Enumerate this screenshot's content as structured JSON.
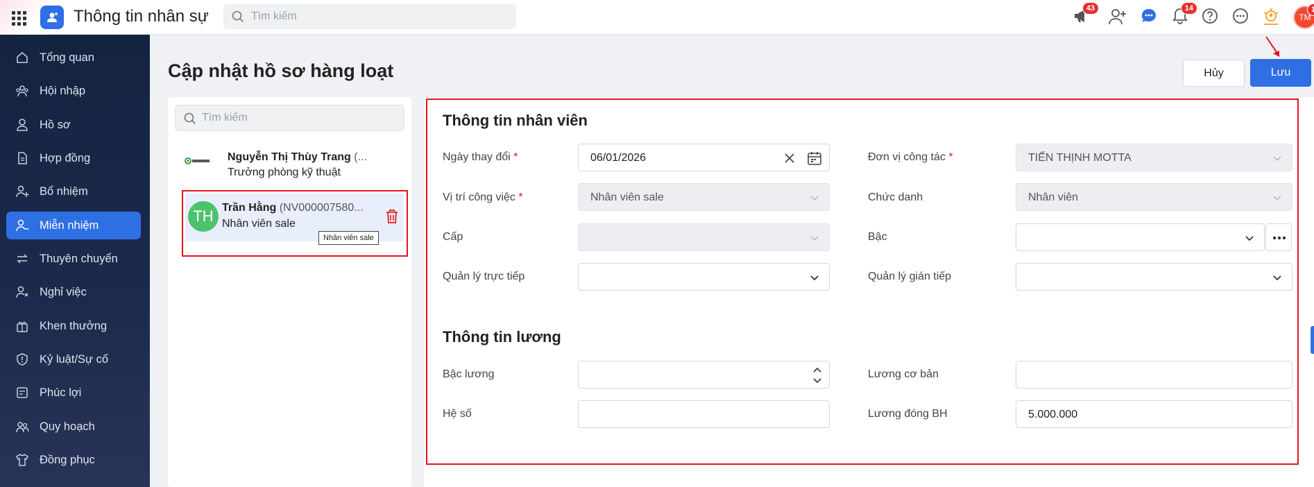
{
  "app": {
    "title": "Thông tin nhân sự"
  },
  "search": {
    "placeholder": "Tìm kiếm"
  },
  "topbar": {
    "icons": [
      {
        "name": "megaphone-icon",
        "badge": "43"
      },
      {
        "name": "add-user-icon",
        "badge": ""
      },
      {
        "name": "chat-icon",
        "badge": ""
      },
      {
        "name": "bell-icon",
        "badge": "14"
      },
      {
        "name": "help-icon",
        "badge": ""
      },
      {
        "name": "more-icon",
        "badge": ""
      },
      {
        "name": "checkin-icon",
        "badge": ""
      }
    ],
    "avatar_initials": "TM",
    "avatar_badge": "1"
  },
  "sidebar": {
    "items": [
      {
        "label": "Tổng quan",
        "icon": "home-icon",
        "active": false
      },
      {
        "label": "Hội nhập",
        "icon": "onboarding-icon",
        "active": false
      },
      {
        "label": "Hồ sơ",
        "icon": "profile-icon",
        "active": false
      },
      {
        "label": "Hợp đồng",
        "icon": "contract-icon",
        "active": false
      },
      {
        "label": "Bổ nhiệm",
        "icon": "appoint-icon",
        "active": false
      },
      {
        "label": "Miễn nhiệm",
        "icon": "dismiss-icon",
        "active": true
      },
      {
        "label": "Thuyên chuyển",
        "icon": "transfer-icon",
        "active": false
      },
      {
        "label": "Nghỉ việc",
        "icon": "resign-icon",
        "active": false
      },
      {
        "label": "Khen thưởng",
        "icon": "reward-icon",
        "active": false
      },
      {
        "label": "Kỷ luật/Sự cố",
        "icon": "discipline-icon",
        "active": false
      },
      {
        "label": "Phúc lợi",
        "icon": "welfare-icon",
        "active": false
      },
      {
        "label": "Quy hoạch",
        "icon": "planning-icon",
        "active": false
      },
      {
        "label": "Đồng phục",
        "icon": "uniform-icon",
        "active": false
      }
    ]
  },
  "page": {
    "title": "Cập nhật hồ sơ hàng loạt",
    "cancel_label": "Hủy",
    "save_label": "Lưu"
  },
  "employee_list": {
    "search_placeholder": "Tìm kiếm",
    "items": [
      {
        "name": "Nguyễn Thị Thùy Trang",
        "code": "(...",
        "role": "Trưởng phòng kỹ thuật",
        "avatar": "company-logo"
      },
      {
        "name": "Trần Hằng",
        "code": "(NV000007580...",
        "role": "Nhân viên sale",
        "avatar": "TH"
      }
    ],
    "tooltip": "Nhân viên sale"
  },
  "employee_info": {
    "title": "Thông tin nhân viên",
    "fields": {
      "change_date": {
        "label": "Ngày thay đổi",
        "required": "*",
        "value": "06/01/2026"
      },
      "work_unit": {
        "label": "Đơn vị công tác",
        "required": "*",
        "value": "TIẾN THỊNH MOTTA"
      },
      "job_position": {
        "label": "Vị trí công việc",
        "required": "*",
        "value": "Nhân viên sale"
      },
      "job_title": {
        "label": "Chức danh",
        "value": "Nhân viên"
      },
      "level": {
        "label": "Cấp",
        "value": ""
      },
      "grade": {
        "label": "Bậc",
        "value": ""
      },
      "direct_manager": {
        "label": "Quản lý trực tiếp",
        "value": ""
      },
      "indirect_manager": {
        "label": "Quản lý gián tiếp",
        "value": ""
      }
    }
  },
  "salary_info": {
    "title": "Thông tin lương",
    "fields": {
      "salary_grade": {
        "label": "Bậc lương",
        "value": ""
      },
      "base_salary": {
        "label": "Lương cơ bản",
        "value": ""
      },
      "coefficient": {
        "label": "Hệ số",
        "value": ""
      },
      "insurance_salary": {
        "label": "Lương đóng BH",
        "value": "5.000.000"
      }
    }
  },
  "colors": {
    "primary": "#2f6fe4",
    "highlight": "#e5121c",
    "sidebar": "#14233f",
    "avatar_green": "#4cc26a"
  }
}
